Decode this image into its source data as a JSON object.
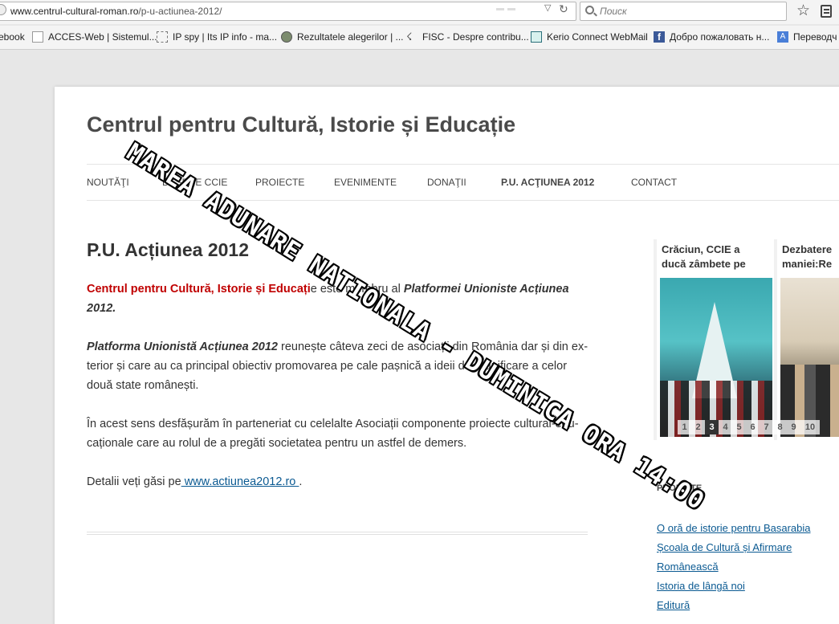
{
  "browser": {
    "url_host": "www.centrul-cultural-roman.ro",
    "url_path": "/p-u-actiunea-2012/",
    "search_placeholder": "Поиск"
  },
  "bookmarks": [
    {
      "label": "ebook",
      "icon": "none"
    },
    {
      "label": "ACCES-Web | Sistemul...",
      "icon": "document-icon"
    },
    {
      "label": "IP spy | Its IP info - ma...",
      "icon": "dashed-box-icon"
    },
    {
      "label": "Rezultatele alegerilor | ...",
      "icon": "seal-icon"
    },
    {
      "label": "FISC - Despre contribu...",
      "icon": "fisc-icon"
    },
    {
      "label": "Kerio Connect WebMail",
      "icon": "kerio-icon"
    },
    {
      "label": "Добро пожаловать н...",
      "icon": "facebook-icon"
    },
    {
      "label": "Переводч",
      "icon": "translate-icon"
    }
  ],
  "site": {
    "title": "Centrul pentru Cultură, Istorie și Educație"
  },
  "nav": {
    "items": [
      "NOUTĂŢI",
      "DESPRE CCIE",
      "PROIECTE",
      "EVENIMENTE",
      "DONAŢII",
      "P.U. ACŢIUNEA 2012",
      "CONTACT"
    ],
    "current_index": 5
  },
  "entry": {
    "title": "P.U. Acțiunea 2012",
    "p1_red": "Centrul pentru Cultură, Istorie și Educați",
    "p1_text": "e este membru al ",
    "p1_bi": "Platformei Unioniste Acțiunea 2012.",
    "p2_bi": "Platforma Unionistă Acțiunea 2012",
    "p2_text": " reunește câteva zeci de asociații din România dar și din ex-terior și care au ca principal obiectiv promovarea pe cale pașnică a ideii de reunificare a celor două state românești.",
    "p3_text": "În acest sens desfășurăm în parteneriat cu celelalte Asociații componente proiecte cultural-edu-caționale   care au rolul de a pregăti societatea pentru un astfel de demers.",
    "p4_text": "Detalii veți găsi pe",
    "p4_link": " www.actiunea2012.ro ",
    "p4_end": "."
  },
  "slider": {
    "slides": [
      {
        "title_line1": "Crăciun, CCIE a",
        "title_line2": "ducă zâmbete pe"
      },
      {
        "title_line1": "Dezbatere",
        "title_line2": "maniei:Re"
      }
    ],
    "pages": [
      "1",
      "2",
      "3",
      "4",
      "5",
      "6",
      "7",
      "8",
      "9",
      "10"
    ],
    "active_page": "3"
  },
  "sidebar": {
    "heading": "PROIECTE",
    "links": [
      "O oră de istorie pentru Basarabia",
      "Școala de Cultură și Afirmare",
      "Românească",
      "Istoria de lângă noi",
      "Editură"
    ]
  },
  "banner": {
    "text": "MAREA ADUNARE NATIONALA - DUMINICA ORA 14:00"
  }
}
